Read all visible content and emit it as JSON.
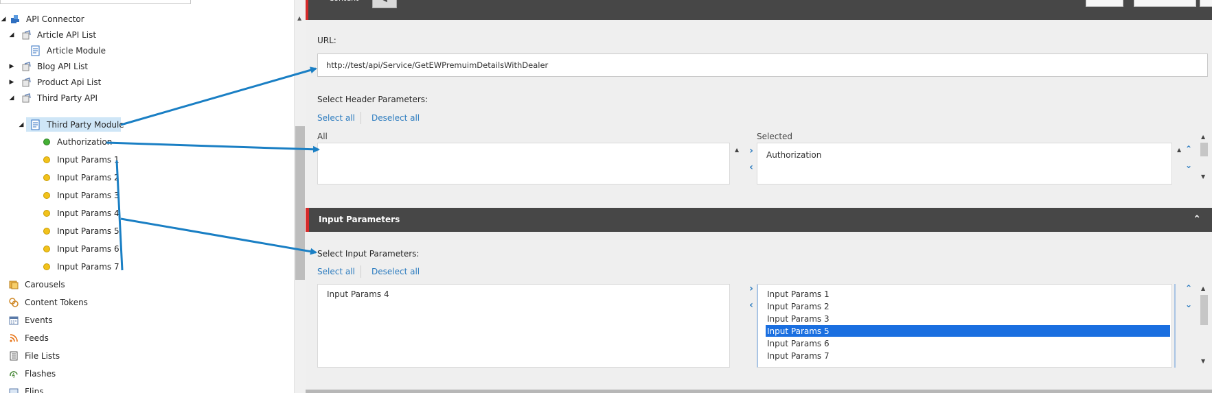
{
  "tree": {
    "items": [
      {
        "label": "API Connector",
        "icon": "api-connector-icon"
      },
      {
        "label": "Article API List",
        "icon": "link-list-icon"
      },
      {
        "label": "Article Module",
        "icon": "module-icon"
      },
      {
        "label": "Blog API List",
        "icon": "link-list-icon"
      },
      {
        "label": "Product Api List",
        "icon": "link-list-icon"
      },
      {
        "label": "Third Party API",
        "icon": "link-list-icon"
      },
      {
        "label": "Third Party Module",
        "icon": "module-icon"
      },
      {
        "label": "Authorization",
        "icon": "green-dot-icon"
      },
      {
        "label": "Input Params 1",
        "icon": "yellow-dot-icon"
      },
      {
        "label": "Input Params 2",
        "icon": "yellow-dot-icon"
      },
      {
        "label": "Input Params 3",
        "icon": "yellow-dot-icon"
      },
      {
        "label": "Input Params 4",
        "icon": "yellow-dot-icon"
      },
      {
        "label": "Input Params 5",
        "icon": "yellow-dot-icon"
      },
      {
        "label": "Input Params 6",
        "icon": "yellow-dot-icon"
      },
      {
        "label": "Input Params 7",
        "icon": "yellow-dot-icon"
      },
      {
        "label": "Carousels",
        "icon": "carousels-icon"
      },
      {
        "label": "Content Tokens",
        "icon": "content-tokens-icon"
      },
      {
        "label": "Events",
        "icon": "calendar-icon"
      },
      {
        "label": "Feeds",
        "icon": "rss-icon"
      },
      {
        "label": "File Lists",
        "icon": "file-list-icon"
      },
      {
        "label": "Flashes",
        "icon": "flash-icon"
      },
      {
        "label": "Flips",
        "icon": "flip-icon"
      }
    ]
  },
  "editor": {
    "tab_label": "Content",
    "url_label": "URL:",
    "url_value": "http://test/api/Service/GetEWPremuimDetailsWithDealer",
    "header_params_label": "Select Header Parameters:",
    "select_all": "Select all",
    "deselect_all": "Deselect all",
    "all_caption": "All",
    "selected_caption": "Selected",
    "header_selected": [
      "Authorization"
    ],
    "section_title": "Input Parameters",
    "input_params_label": "Select Input Parameters:",
    "input_all": [
      "Input Params 4"
    ],
    "input_selected": [
      "Input Params 1",
      "Input Params 2",
      "Input Params 3",
      "Input Params 5",
      "Input Params 6",
      "Input Params 7"
    ],
    "input_selected_highlight": "Input Params 5"
  },
  "colors": {
    "accent": "#2b7bbf",
    "section_bar": "#474747",
    "red_marker": "#d42a2a",
    "selection": "#1a6fe0",
    "annotation_arrow": "#1a7fc4"
  }
}
